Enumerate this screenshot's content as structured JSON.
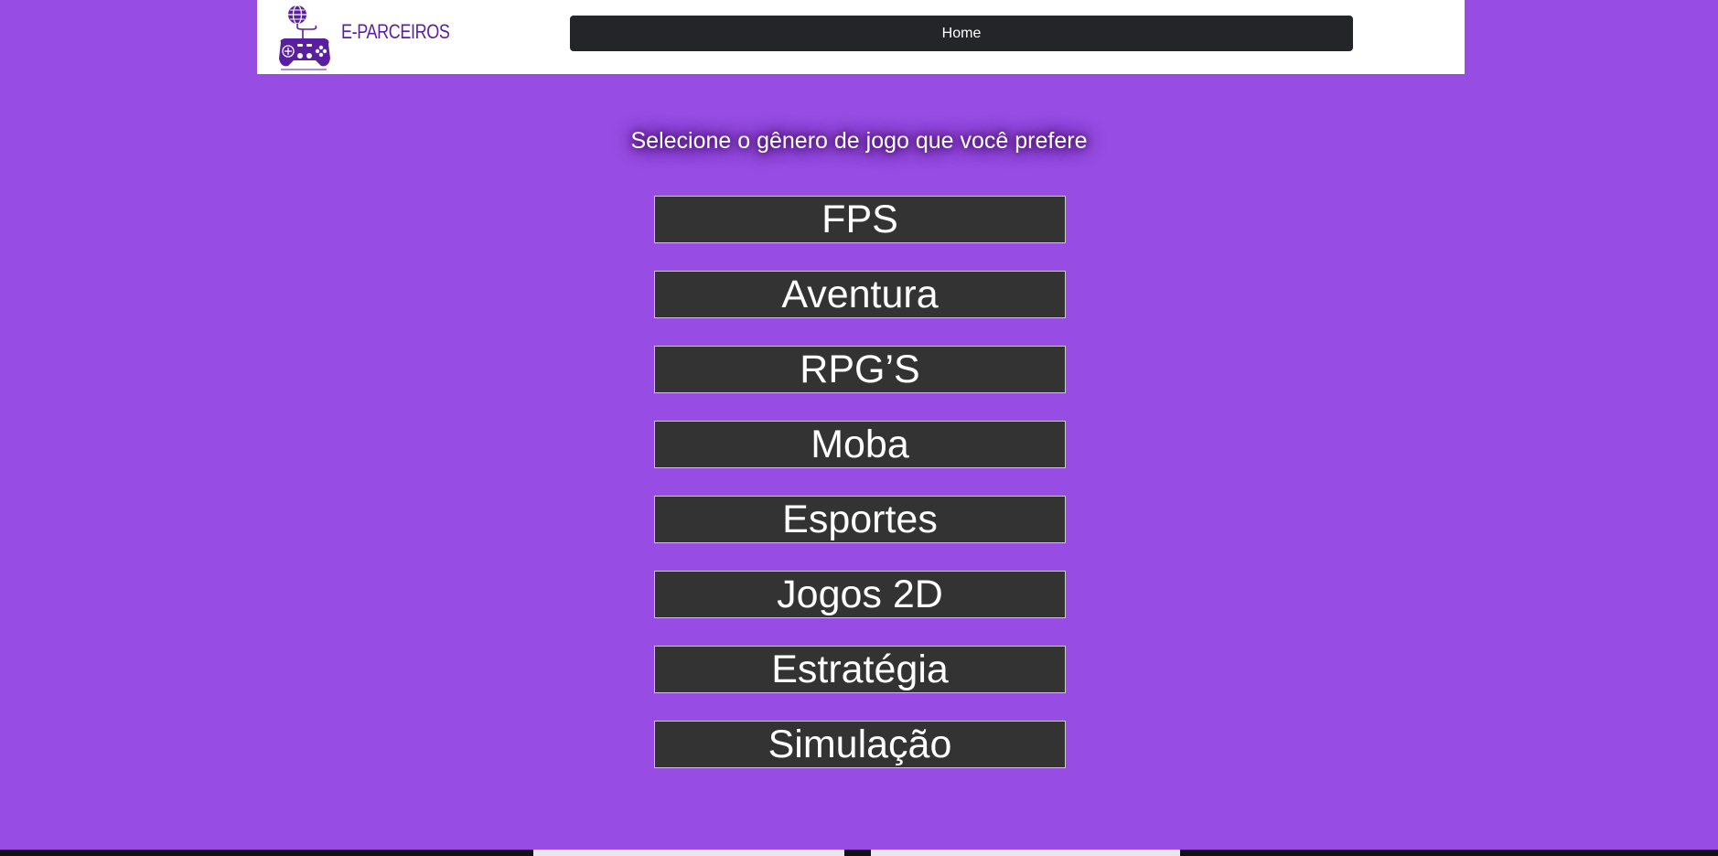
{
  "header": {
    "brand": "E-PARCEIROS",
    "logo_icon": "gamepad-globe-icon",
    "nav": {
      "home_label": "Home"
    }
  },
  "main": {
    "prompt": "Selecione o gênero de jogo que você prefere",
    "genres": [
      "FPS",
      "Aventura",
      "RPG’S",
      "Moba",
      "Esportes",
      "Jogos 2D",
      "Estratégia",
      "Simulação"
    ]
  },
  "colors": {
    "background": "#974ce3",
    "button": "#333333",
    "nav_button": "#232528",
    "brand": "#5a1fa1"
  }
}
